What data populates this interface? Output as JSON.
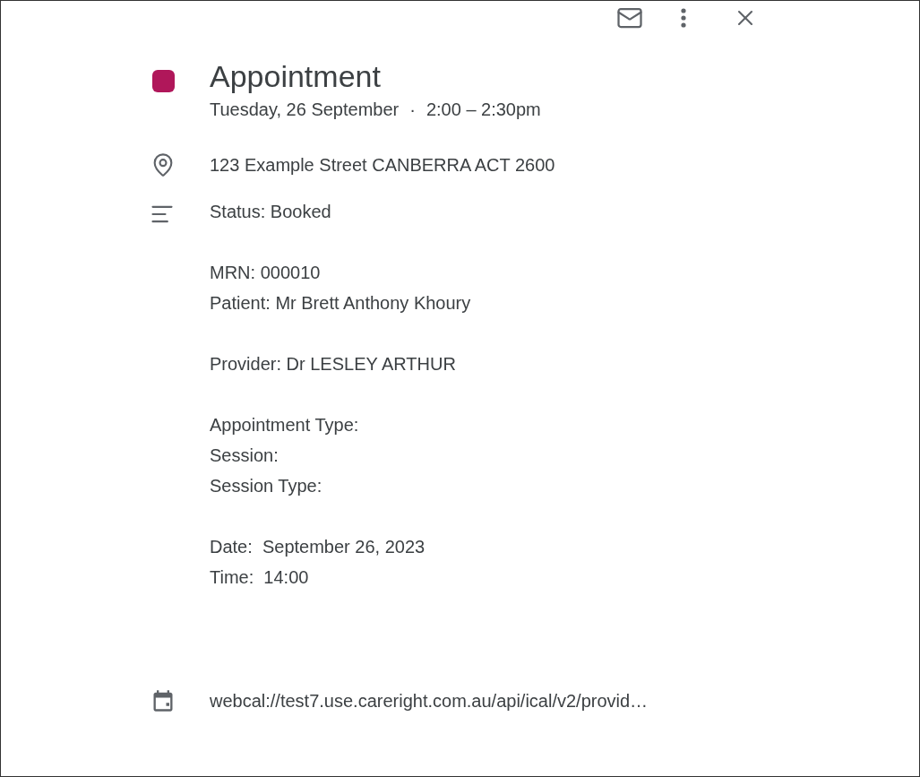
{
  "event": {
    "title": "Appointment",
    "color": "#b0175a",
    "date": "Tuesday, 26 September",
    "separator": "·",
    "time": "2:00 – 2:30pm"
  },
  "location": "123 Example Street CANBERRA ACT 2600",
  "description": [
    [
      "Status: Booked"
    ],
    [
      "MRN: 000010",
      "Patient: Mr Brett Anthony Khoury"
    ],
    [
      "Provider: Dr LESLEY ARTHUR"
    ],
    [
      "Appointment Type:",
      "Session:",
      "Session Type:"
    ],
    [
      "Date:  September 26, 2023",
      "Time:  14:00"
    ]
  ],
  "calendar": "webcal://test7.use.careright.com.au/api/ical/v2/provid…"
}
